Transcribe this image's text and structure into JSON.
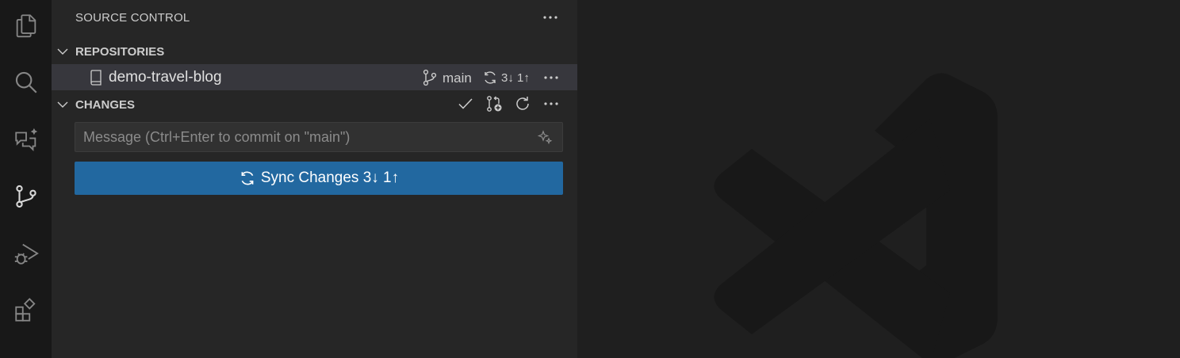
{
  "activity_bar": {
    "icons": [
      "explorer-icon",
      "search-icon",
      "chat-icon",
      "source-control-icon",
      "run-debug-icon",
      "extensions-icon"
    ],
    "active": "source-control-icon"
  },
  "sidebar": {
    "title": "SOURCE CONTROL",
    "repositories": {
      "header": "REPOSITORIES",
      "repo": {
        "name": "demo-travel-blog",
        "branch": "main",
        "sync_counts": "3↓ 1↑"
      }
    },
    "changes": {
      "header": "CHANGES",
      "commit_placeholder": "Message (Ctrl+Enter to commit on \"main\")",
      "commit_value": "",
      "sync_button_label": "Sync Changes 3↓ 1↑"
    }
  },
  "colors": {
    "accent_button": "#2268a0",
    "sidebar_bg": "#262626",
    "selected_row": "#37373d",
    "activity_bar_bg": "#181818"
  }
}
